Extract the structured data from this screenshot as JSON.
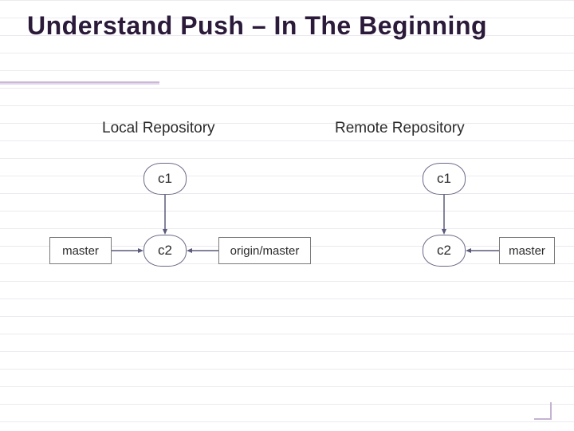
{
  "title": "Understand Push – In The Beginning",
  "headers": {
    "local": "Local Repository",
    "remote": "Remote Repository"
  },
  "local": {
    "c1": "c1",
    "c2": "c2",
    "branch": "master",
    "tracking": "origin/master"
  },
  "remote": {
    "c1": "c1",
    "c2": "c2",
    "branch": "master"
  }
}
